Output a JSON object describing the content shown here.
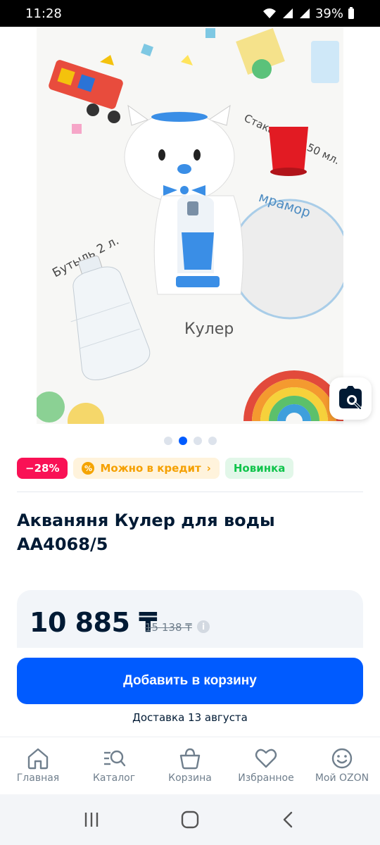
{
  "status_bar": {
    "time": "11:28",
    "battery": "39%"
  },
  "product_image": {
    "alt_labels": {
      "cup": "Стаканчик 150 мл.",
      "marble": "мрамор",
      "bottle": "Бутыль 2 л.",
      "cooler": "Кулер"
    }
  },
  "carousel": {
    "count": 4,
    "active_index": 1
  },
  "badges": {
    "discount": "−28%",
    "credit": "Можно в кредит",
    "credit_chevron": "›",
    "new": "Новинка"
  },
  "product": {
    "title_line1": "Акваняня Кулер для воды",
    "title_line2": "AA4068/5",
    "price": "10 885 ₸",
    "old_price": "15 138 ₸",
    "info_icon_text": "i"
  },
  "actions": {
    "add_to_cart": "Добавить в корзину",
    "delivery": "Доставка 13 августа"
  },
  "bottom_nav": [
    {
      "label": "Главная",
      "icon": "home-icon"
    },
    {
      "label": "Каталог",
      "icon": "catalog-search-icon"
    },
    {
      "label": "Корзина",
      "icon": "basket-icon"
    },
    {
      "label": "Избранное",
      "icon": "heart-icon"
    },
    {
      "label": "Мой OZON",
      "icon": "profile-smile-icon"
    }
  ],
  "colors": {
    "accent": "#005bff",
    "discount": "#f91155",
    "credit": "#f5a000",
    "new": "#10c44c",
    "text": "#001a34",
    "muted": "#707f8d"
  }
}
